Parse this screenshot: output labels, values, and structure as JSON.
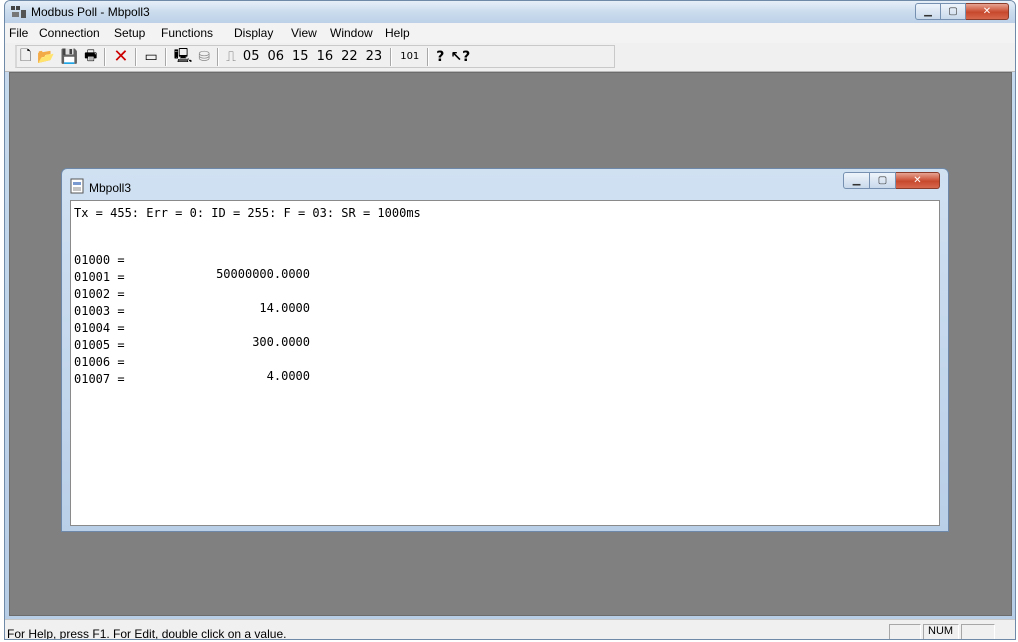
{
  "app": {
    "title": "Modbus Poll - Mbpoll3"
  },
  "menu": [
    "File",
    "Connection",
    "Setup",
    "Functions",
    "Display",
    "View",
    "Window",
    "Help"
  ],
  "toolbar": {
    "function_codes": [
      "05",
      "06",
      "15",
      "16",
      "22",
      "23"
    ],
    "address_mode": "101"
  },
  "child_window": {
    "title": "Mbpoll3",
    "status_line": "Tx = 455: Err = 0: ID = 255: F = 03: SR = 1000ms",
    "registers": [
      {
        "address": "01000 =",
        "value": "50000000.0000"
      },
      {
        "address": "01001 =",
        "value": ""
      },
      {
        "address": "01002 =",
        "value": "14.0000"
      },
      {
        "address": "01003 =",
        "value": ""
      },
      {
        "address": "01004 =",
        "value": "300.0000"
      },
      {
        "address": "01005 =",
        "value": ""
      },
      {
        "address": "01006 =",
        "value": "4.0000"
      },
      {
        "address": "01007 =",
        "value": ""
      }
    ]
  },
  "statusbar": {
    "help_text": "For Help, press F1.  For Edit, double click on a value.",
    "num_indicator": "NUM"
  },
  "colors": {
    "mdi_background": "#808080",
    "close_button": "#c8492d"
  }
}
